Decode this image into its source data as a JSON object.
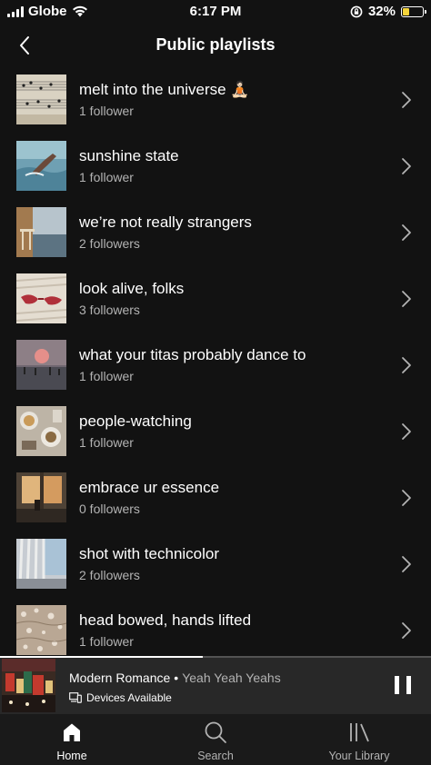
{
  "status_bar": {
    "carrier": "Globe",
    "time": "6:17 PM",
    "battery_percent": "32%",
    "icons": [
      "signal-icon",
      "wifi-icon",
      "orientation-lock-icon",
      "battery-icon"
    ]
  },
  "header": {
    "title": "Public playlists",
    "back_icon": "chevron-left-icon"
  },
  "playlists": [
    {
      "name": "melt into the universe 🧘🏻",
      "followers": "1 follower",
      "art": "sheet-music"
    },
    {
      "name": "sunshine state",
      "followers": "1 follower",
      "art": "ocean-diver"
    },
    {
      "name": "we’re not really strangers",
      "followers": "2 followers",
      "art": "balcony-sea"
    },
    {
      "name": "look alive, folks",
      "followers": "3 followers",
      "art": "red-sunglasses"
    },
    {
      "name": "what your titas probably dance to",
      "followers": "1 follower",
      "art": "pink-sunset"
    },
    {
      "name": "people-watching",
      "followers": "1 follower",
      "art": "breakfast-table"
    },
    {
      "name": "embrace ur essence",
      "followers": "0 followers",
      "art": "window-light"
    },
    {
      "name": "shot with technicolor",
      "followers": "2 followers",
      "art": "curtains"
    },
    {
      "name": "head bowed, hands lifted",
      "followers": "1 follower",
      "art": "water-sparkles"
    }
  ],
  "player": {
    "song": "Modern Romance",
    "separator": "•",
    "artist": "Yeah Yeah Yeahs",
    "devices": "Devices Available",
    "devices_icon": "devices-icon",
    "control_icon": "pause-icon",
    "progress": 0.47
  },
  "nav": {
    "home": "Home",
    "search": "Search",
    "library": "Your Library"
  },
  "colors": {
    "background": "#121212",
    "player": "#282828",
    "secondary_text": "#b3b3b3",
    "battery": "#f4d33a"
  }
}
